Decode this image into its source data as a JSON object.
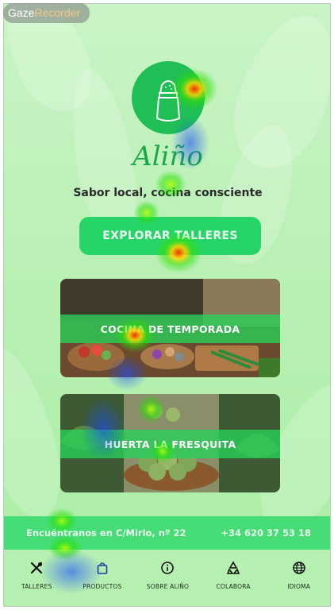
{
  "watermark": {
    "part1": "Gaze",
    "part2": "Recorder"
  },
  "brand": {
    "name": "Aliño",
    "tagline": "Sabor local, cocina consciente"
  },
  "cta": {
    "label": "EXPLORAR TALLERES"
  },
  "cards": [
    {
      "label": "COCINA DE TEMPORADA"
    },
    {
      "label": "HUERTA LA FRESQUITA"
    }
  ],
  "info": {
    "address": "Encuéntranos en C/Mirlo, nº 22",
    "phone": "+34 620 37 53 18"
  },
  "nav": [
    {
      "label": "TALLERES",
      "icon": "utensils-icon"
    },
    {
      "label": "PRODUCTOS",
      "icon": "shopping-bag-icon"
    },
    {
      "label": "SOBRE ALIÑO",
      "icon": "info-icon"
    },
    {
      "label": "COLABORA",
      "icon": "recycle-icon"
    },
    {
      "label": "IDIOMA",
      "icon": "globe-icon"
    }
  ],
  "colors": {
    "primary": "#27d468",
    "brand": "#1aa74a",
    "background": "#bdf2b8"
  }
}
